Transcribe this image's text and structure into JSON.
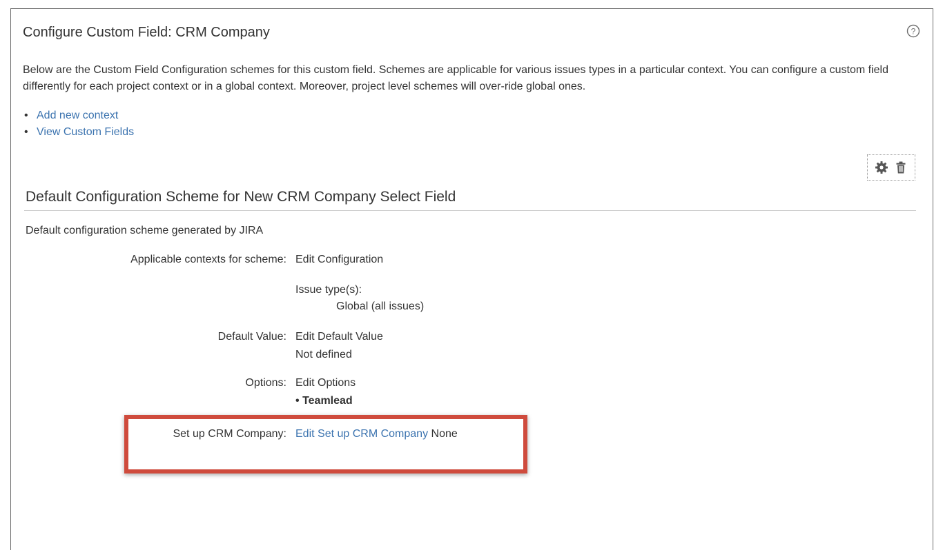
{
  "page": {
    "title": "Configure Custom Field: CRM Company",
    "description": "Below are the Custom Field Configuration schemes for this custom field. Schemes are applicable for various issues types in a particular context. You can configure a custom field differently for each project context or in a global context. Moreover, project level schemes will over-ride global ones.",
    "links": [
      "Add new context",
      "View Custom Fields"
    ]
  },
  "scheme": {
    "title": "Default Configuration Scheme for New CRM Company Select Field",
    "description": "Default configuration scheme generated by JIRA",
    "applicable_contexts": {
      "label": "Applicable contexts for scheme:",
      "link": "Edit Configuration",
      "issue_types_label": "Issue type(s):",
      "issue_types_value": "Global (all issues)"
    },
    "default_value": {
      "label": "Default Value:",
      "link": "Edit Default Value",
      "value": "Not defined"
    },
    "options": {
      "label": "Options:",
      "link": "Edit Options",
      "items": [
        "Teamlead"
      ]
    },
    "setup": {
      "label": "Set up CRM Company:",
      "link": "Edit Set up CRM Company",
      "value": "None"
    }
  },
  "icons": {
    "help": "help-icon",
    "configure": "gear-icon",
    "delete": "trash-icon"
  },
  "colors": {
    "link": "#3b73af",
    "highlight": "#cf4b3d",
    "text": "#333333"
  }
}
